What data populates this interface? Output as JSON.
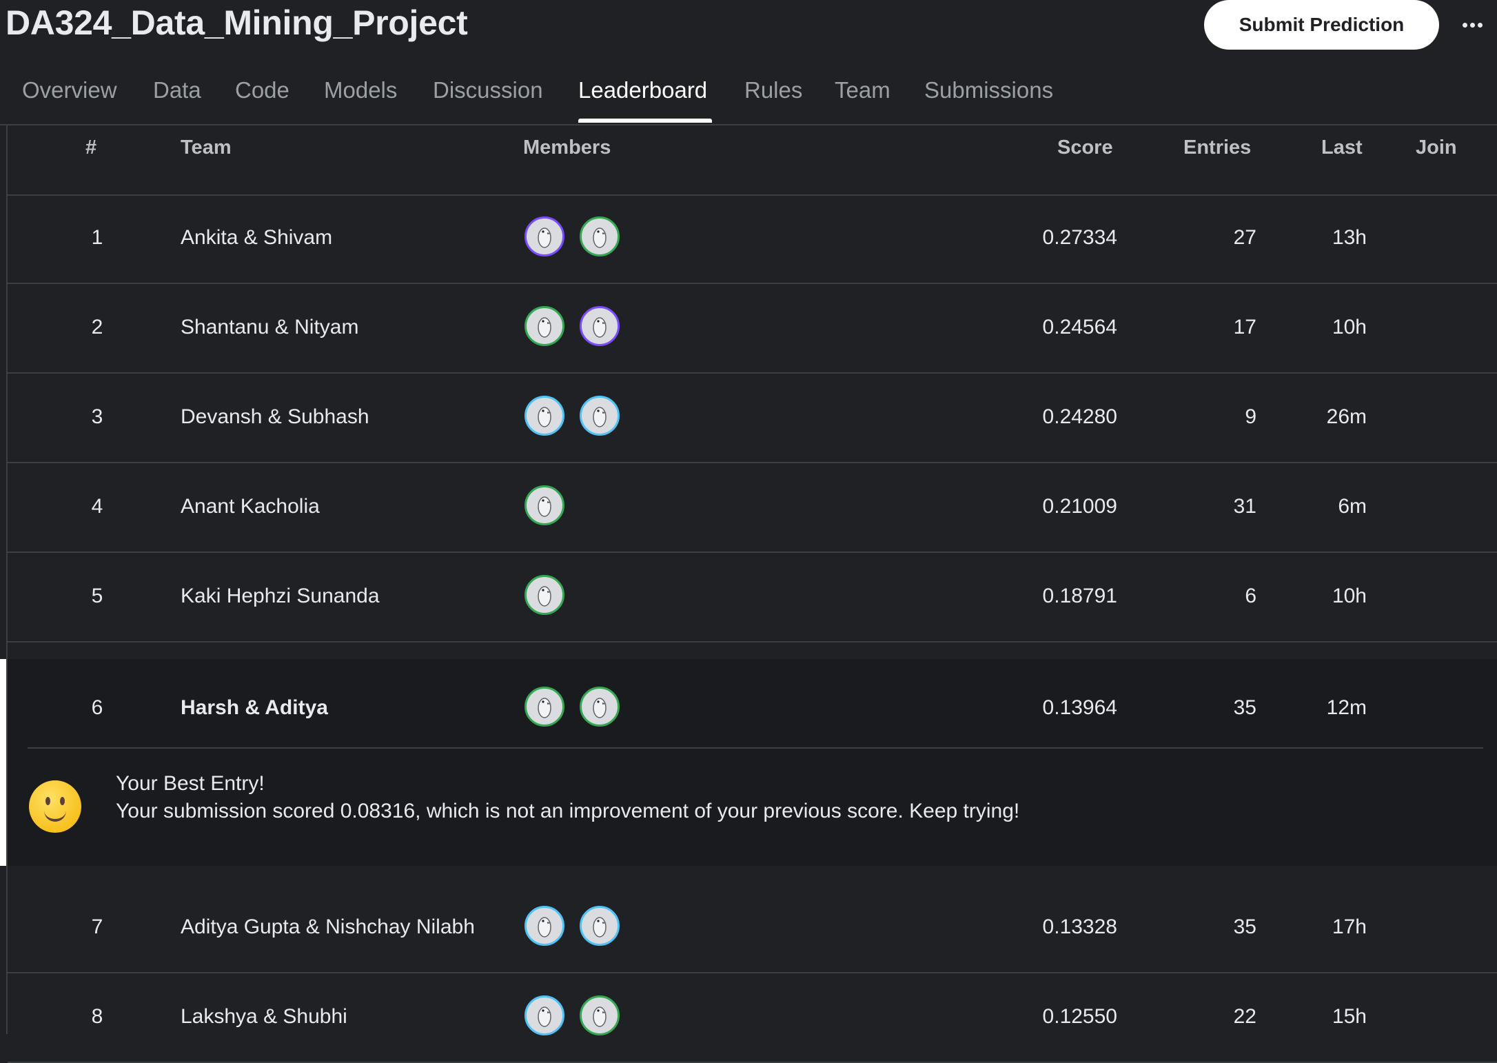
{
  "header": {
    "title": "DA324_Data_Mining_Project",
    "submit_label": "Submit Prediction"
  },
  "tabs": [
    {
      "label": "Overview"
    },
    {
      "label": "Data"
    },
    {
      "label": "Code"
    },
    {
      "label": "Models"
    },
    {
      "label": "Discussion"
    },
    {
      "label": "Leaderboard",
      "active": true
    },
    {
      "label": "Rules"
    },
    {
      "label": "Team"
    },
    {
      "label": "Submissions"
    }
  ],
  "table": {
    "columns": [
      "#",
      "Team",
      "Members",
      "Score",
      "Entries",
      "Last",
      "Join"
    ],
    "rows": [
      {
        "rank": "1",
        "team": "Ankita & Shivam",
        "members": 2,
        "score": "0.27334",
        "entries": "27",
        "last": "13h"
      },
      {
        "rank": "2",
        "team": "Shantanu & Nityam",
        "members": 2,
        "score": "0.24564",
        "entries": "17",
        "last": "10h"
      },
      {
        "rank": "3",
        "team": "Devansh & Subhash",
        "members": 2,
        "score": "0.24280",
        "entries": "9",
        "last": "26m"
      },
      {
        "rank": "4",
        "team": "Anant Kacholia",
        "members": 1,
        "score": "0.21009",
        "entries": "31",
        "last": "6m"
      },
      {
        "rank": "5",
        "team": "Kaki Hephzi Sunanda",
        "members": 1,
        "score": "0.18791",
        "entries": "6",
        "last": "10h"
      },
      {
        "rank": "6",
        "team": "Harsh & Aditya",
        "members": 2,
        "score": "0.13964",
        "entries": "35",
        "last": "12m"
      },
      {
        "rank": "7",
        "team": "Aditya Gupta & Nishchay Nilabh",
        "members": 2,
        "score": "0.13328",
        "entries": "35",
        "last": "17h"
      },
      {
        "rank": "8",
        "team": "Lakshya & Shubhi",
        "members": 2,
        "score": "0.12550",
        "entries": "22",
        "last": "15h"
      }
    ]
  },
  "highlight": {
    "title": "Your Best Entry!",
    "body": "Your submission scored 0.08316, which is not an improvement of your previous score. Keep trying!"
  },
  "colors": {
    "background": "#202124",
    "accent_ring_purple": "#7c4dff",
    "accent_ring_green": "#34a853",
    "accent_ring_blue": "#4fc3f7"
  }
}
